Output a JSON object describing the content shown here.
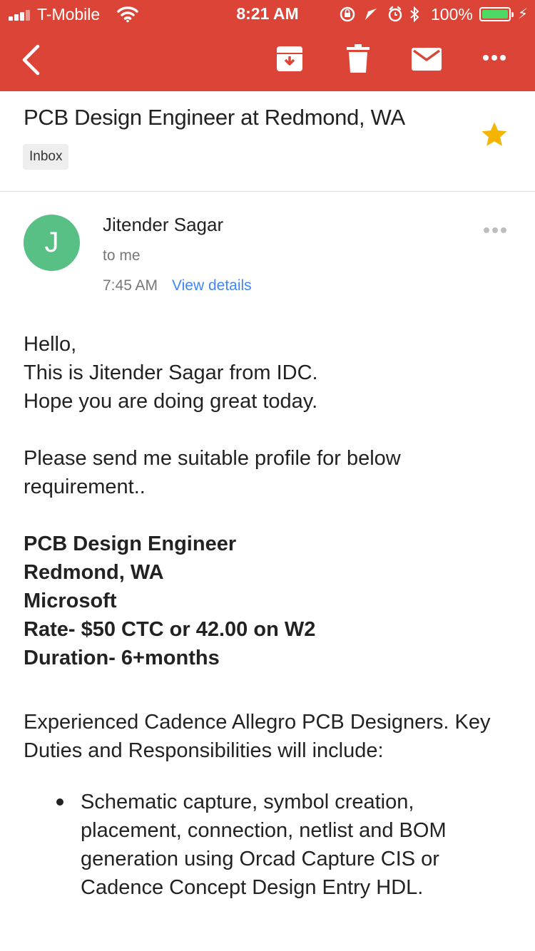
{
  "status_bar": {
    "carrier": "T-Mobile",
    "time": "8:21 AM",
    "battery": "100%",
    "colors": {
      "battery_fill": "#4cd964"
    }
  },
  "toolbar": {
    "background": "#db4437",
    "icons": [
      "back-arrow-icon",
      "archive-icon",
      "trash-icon",
      "mail-icon",
      "more-horizontal-icon"
    ]
  },
  "email": {
    "subject": "PCB Design Engineer at Redmond, WA",
    "label": "Inbox",
    "starred": true,
    "sender": {
      "initial": "J",
      "name": "Jitender Sagar",
      "to": "to me",
      "time": "7:45 AM",
      "view_details": "View details",
      "avatar_color": "#58bf85"
    },
    "body": {
      "greeting": "Hello,",
      "intro1": "This is Jitender Sagar from IDC.",
      "intro2": "Hope you are doing great today.",
      "request": "Please send me suitable profile for below requirement..",
      "job_title": "PCB Design Engineer",
      "location": "Redmond, WA",
      "client": "Microsoft",
      "rate": "Rate- $50 CTC or 42.00 on W2",
      "duration": "Duration- 6+months",
      "description": "Experienced Cadence Allegro PCB Designers. Key Duties and Responsibilities will include:",
      "bullets": [
        "Schematic capture, symbol creation, placement, connection, netlist and BOM generation using Orcad Capture CIS or Cadence Concept Design Entry HDL."
      ]
    }
  }
}
